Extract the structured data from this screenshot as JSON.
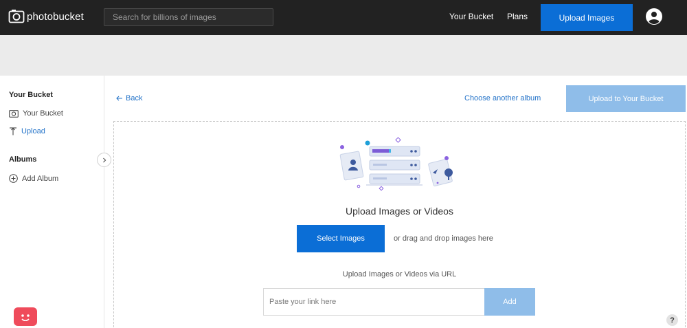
{
  "header": {
    "logo_text": "photobucket",
    "search_placeholder": "Search for billions of images",
    "nav": [
      "Your Bucket",
      "Plans"
    ],
    "upload_button": "Upload Images"
  },
  "sidebar": {
    "bucket_heading": "Your Bucket",
    "items": [
      {
        "label": "Your Bucket",
        "icon": "bucket-icon"
      },
      {
        "label": "Upload",
        "icon": "upload-icon"
      }
    ],
    "albums_heading": "Albums",
    "add_album": "Add Album"
  },
  "main": {
    "back_label": "Back",
    "choose_album": "Choose another album",
    "upload_to_bucket": "Upload to Your Bucket",
    "upload_title": "Upload Images or Videos",
    "select_button": "Select Images",
    "drag_text": "or drag and drop images here",
    "url_title": "Upload Images or Videos via URL",
    "url_placeholder": "Paste your link here",
    "add_button": "Add"
  },
  "help_label": "?",
  "colors": {
    "topbar": "#222222",
    "primary": "#0b6ed6",
    "primary_disabled": "#8fbde9",
    "link": "#2574c9",
    "chat": "#ef4b5b"
  }
}
